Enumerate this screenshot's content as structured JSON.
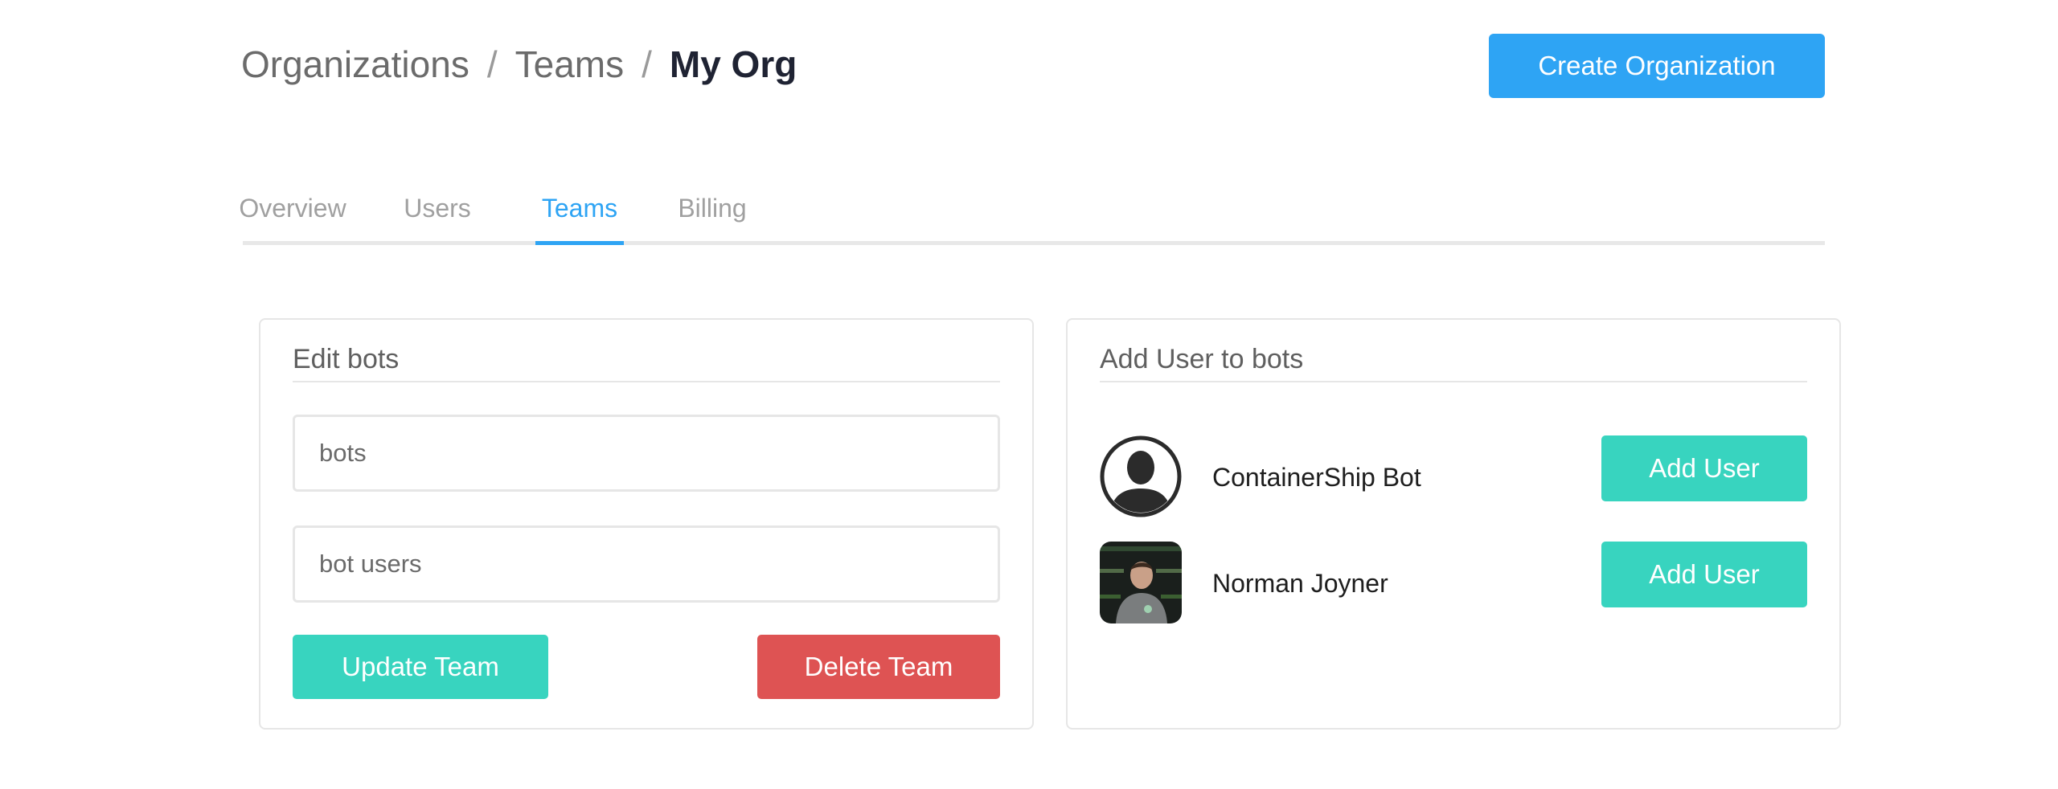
{
  "breadcrumb": {
    "items": [
      "Organizations",
      "Teams"
    ],
    "current": "My Org",
    "separator": "/"
  },
  "header": {
    "create_button": "Create Organization"
  },
  "tabs": [
    {
      "label": "Overview",
      "active": false
    },
    {
      "label": "Users",
      "active": false
    },
    {
      "label": "Teams",
      "active": true
    },
    {
      "label": "Billing",
      "active": false
    }
  ],
  "edit_card": {
    "title": "Edit bots",
    "name_value": "bots",
    "description_value": "bot users",
    "update_button": "Update Team",
    "delete_button": "Delete Team"
  },
  "add_user_card": {
    "title": "Add User to bots",
    "users": [
      {
        "name": "ContainerShip Bot",
        "avatar": "default-user-silhouette",
        "button": "Add User"
      },
      {
        "name": "Norman Joyner",
        "avatar": "user-photo",
        "button": "Add User"
      }
    ]
  },
  "colors": {
    "accent": "#2ea4f4",
    "teal": "#38d4bf",
    "danger": "#de5353"
  }
}
